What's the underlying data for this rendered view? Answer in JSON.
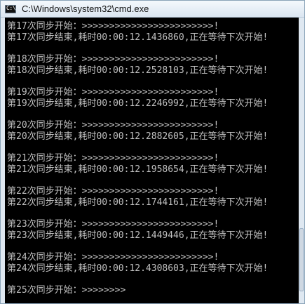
{
  "window": {
    "title": "C:\\Windows\\system32\\cmd.exe",
    "icon_name": "cmd-icon",
    "icon_text": "C:\\"
  },
  "console": {
    "blocks": [
      {
        "start": "第17次同步开始：>>>>>>>>>>>>>>>>>>>>>>>>!",
        "end": "第17次同步结束,耗时00:00:12.1436860,正在等待下次开始!"
      },
      {
        "start": "第18次同步开始：>>>>>>>>>>>>>>>>>>>>>>>>!",
        "end": "第18次同步结束,耗时00:00:12.2528103,正在等待下次开始!"
      },
      {
        "start": "第19次同步开始：>>>>>>>>>>>>>>>>>>>>>>>>!",
        "end": "第19次同步结束,耗时00:00:12.2246992,正在等待下次开始!"
      },
      {
        "start": "第20次同步开始：>>>>>>>>>>>>>>>>>>>>>>>>!",
        "end": "第20次同步结束,耗时00:00:12.2882605,正在等待下次开始!"
      },
      {
        "start": "第21次同步开始：>>>>>>>>>>>>>>>>>>>>>>>>!",
        "end": "第21次同步结束,耗时00:00:12.1958654,正在等待下次开始!"
      },
      {
        "start": "第22次同步开始：>>>>>>>>>>>>>>>>>>>>>>>>!",
        "end": "第22次同步结束,耗时00:00:12.1744161,正在等待下次开始!"
      },
      {
        "start": "第23次同步开始：>>>>>>>>>>>>>>>>>>>>>>>>!",
        "end": "第23次同步结束,耗时00:00:12.1449446,正在等待下次开始!"
      },
      {
        "start": "第24次同步开始：>>>>>>>>>>>>>>>>>>>>>>>>!",
        "end": "第24次同步结束,耗时00:00:12.4308603,正在等待下次开始!"
      }
    ],
    "current": "第25次同步开始：>>>>>>>>"
  }
}
